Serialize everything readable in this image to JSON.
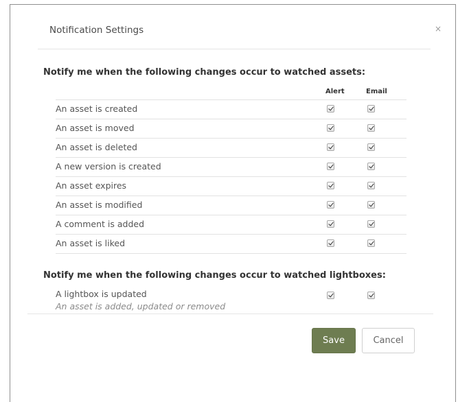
{
  "dialog": {
    "title": "Notification Settings",
    "close_glyph": "×"
  },
  "assets_section": {
    "heading": "Notify me when the following changes occur to watched assets:",
    "columns": {
      "alert": "Alert",
      "email": "Email"
    },
    "rows": [
      {
        "label": "An asset is created",
        "alert": true,
        "email": true
      },
      {
        "label": "An asset is moved",
        "alert": true,
        "email": true
      },
      {
        "label": "An asset is deleted",
        "alert": true,
        "email": true
      },
      {
        "label": "A new version is created",
        "alert": true,
        "email": true
      },
      {
        "label": "An asset expires",
        "alert": true,
        "email": true
      },
      {
        "label": "An asset is modified",
        "alert": true,
        "email": true
      },
      {
        "label": "A comment is added",
        "alert": true,
        "email": true
      },
      {
        "label": "An asset is liked",
        "alert": true,
        "email": true
      }
    ]
  },
  "lightbox_section": {
    "heading": "Notify me when the following changes occur to watched lightboxes:",
    "rows": [
      {
        "label": "A lightbox is updated",
        "sublabel": "An asset is added, updated or removed",
        "alert": true,
        "email": true
      }
    ]
  },
  "footer": {
    "save_label": "Save",
    "cancel_label": "Cancel"
  },
  "colors": {
    "save_button": "#6e7d51",
    "modal_border": "#8f8f8f"
  },
  "icons": {
    "close": "close-icon",
    "checkbox": "checkbox-checked-icon"
  }
}
